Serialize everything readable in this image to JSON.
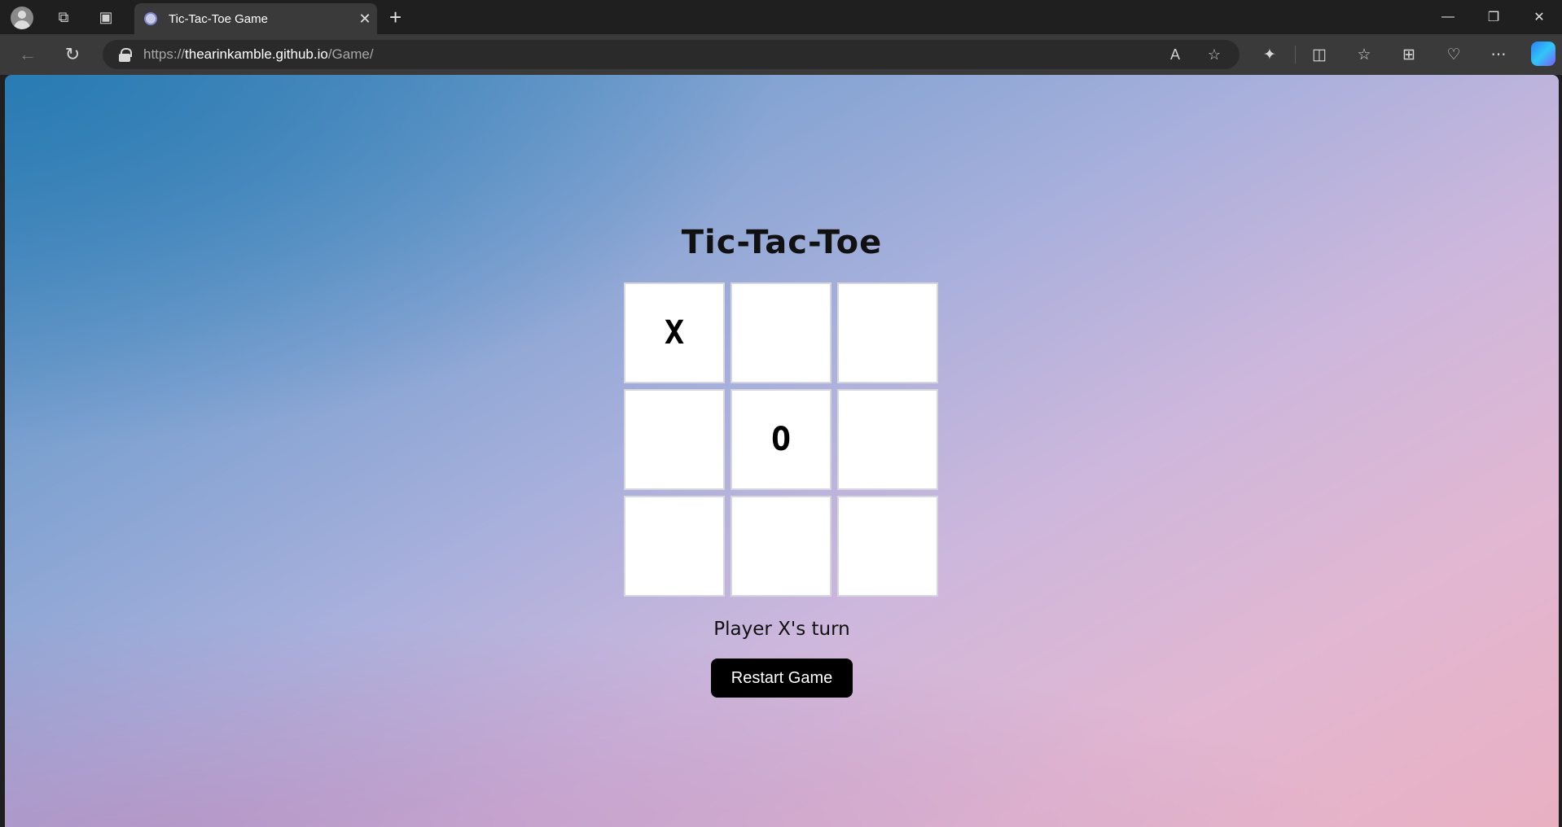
{
  "browser": {
    "tab_title": "Tic-Tac-Toe Game",
    "url_scheme": "https://",
    "url_host": "thearinkamble.github.io",
    "url_path": "/Game/"
  },
  "game": {
    "title": "Tic-Tac-Toe",
    "cells": [
      "X",
      "",
      "",
      "",
      "O",
      "",
      "",
      "",
      ""
    ],
    "status": "Player X's turn",
    "restart_label": "Restart Game"
  }
}
